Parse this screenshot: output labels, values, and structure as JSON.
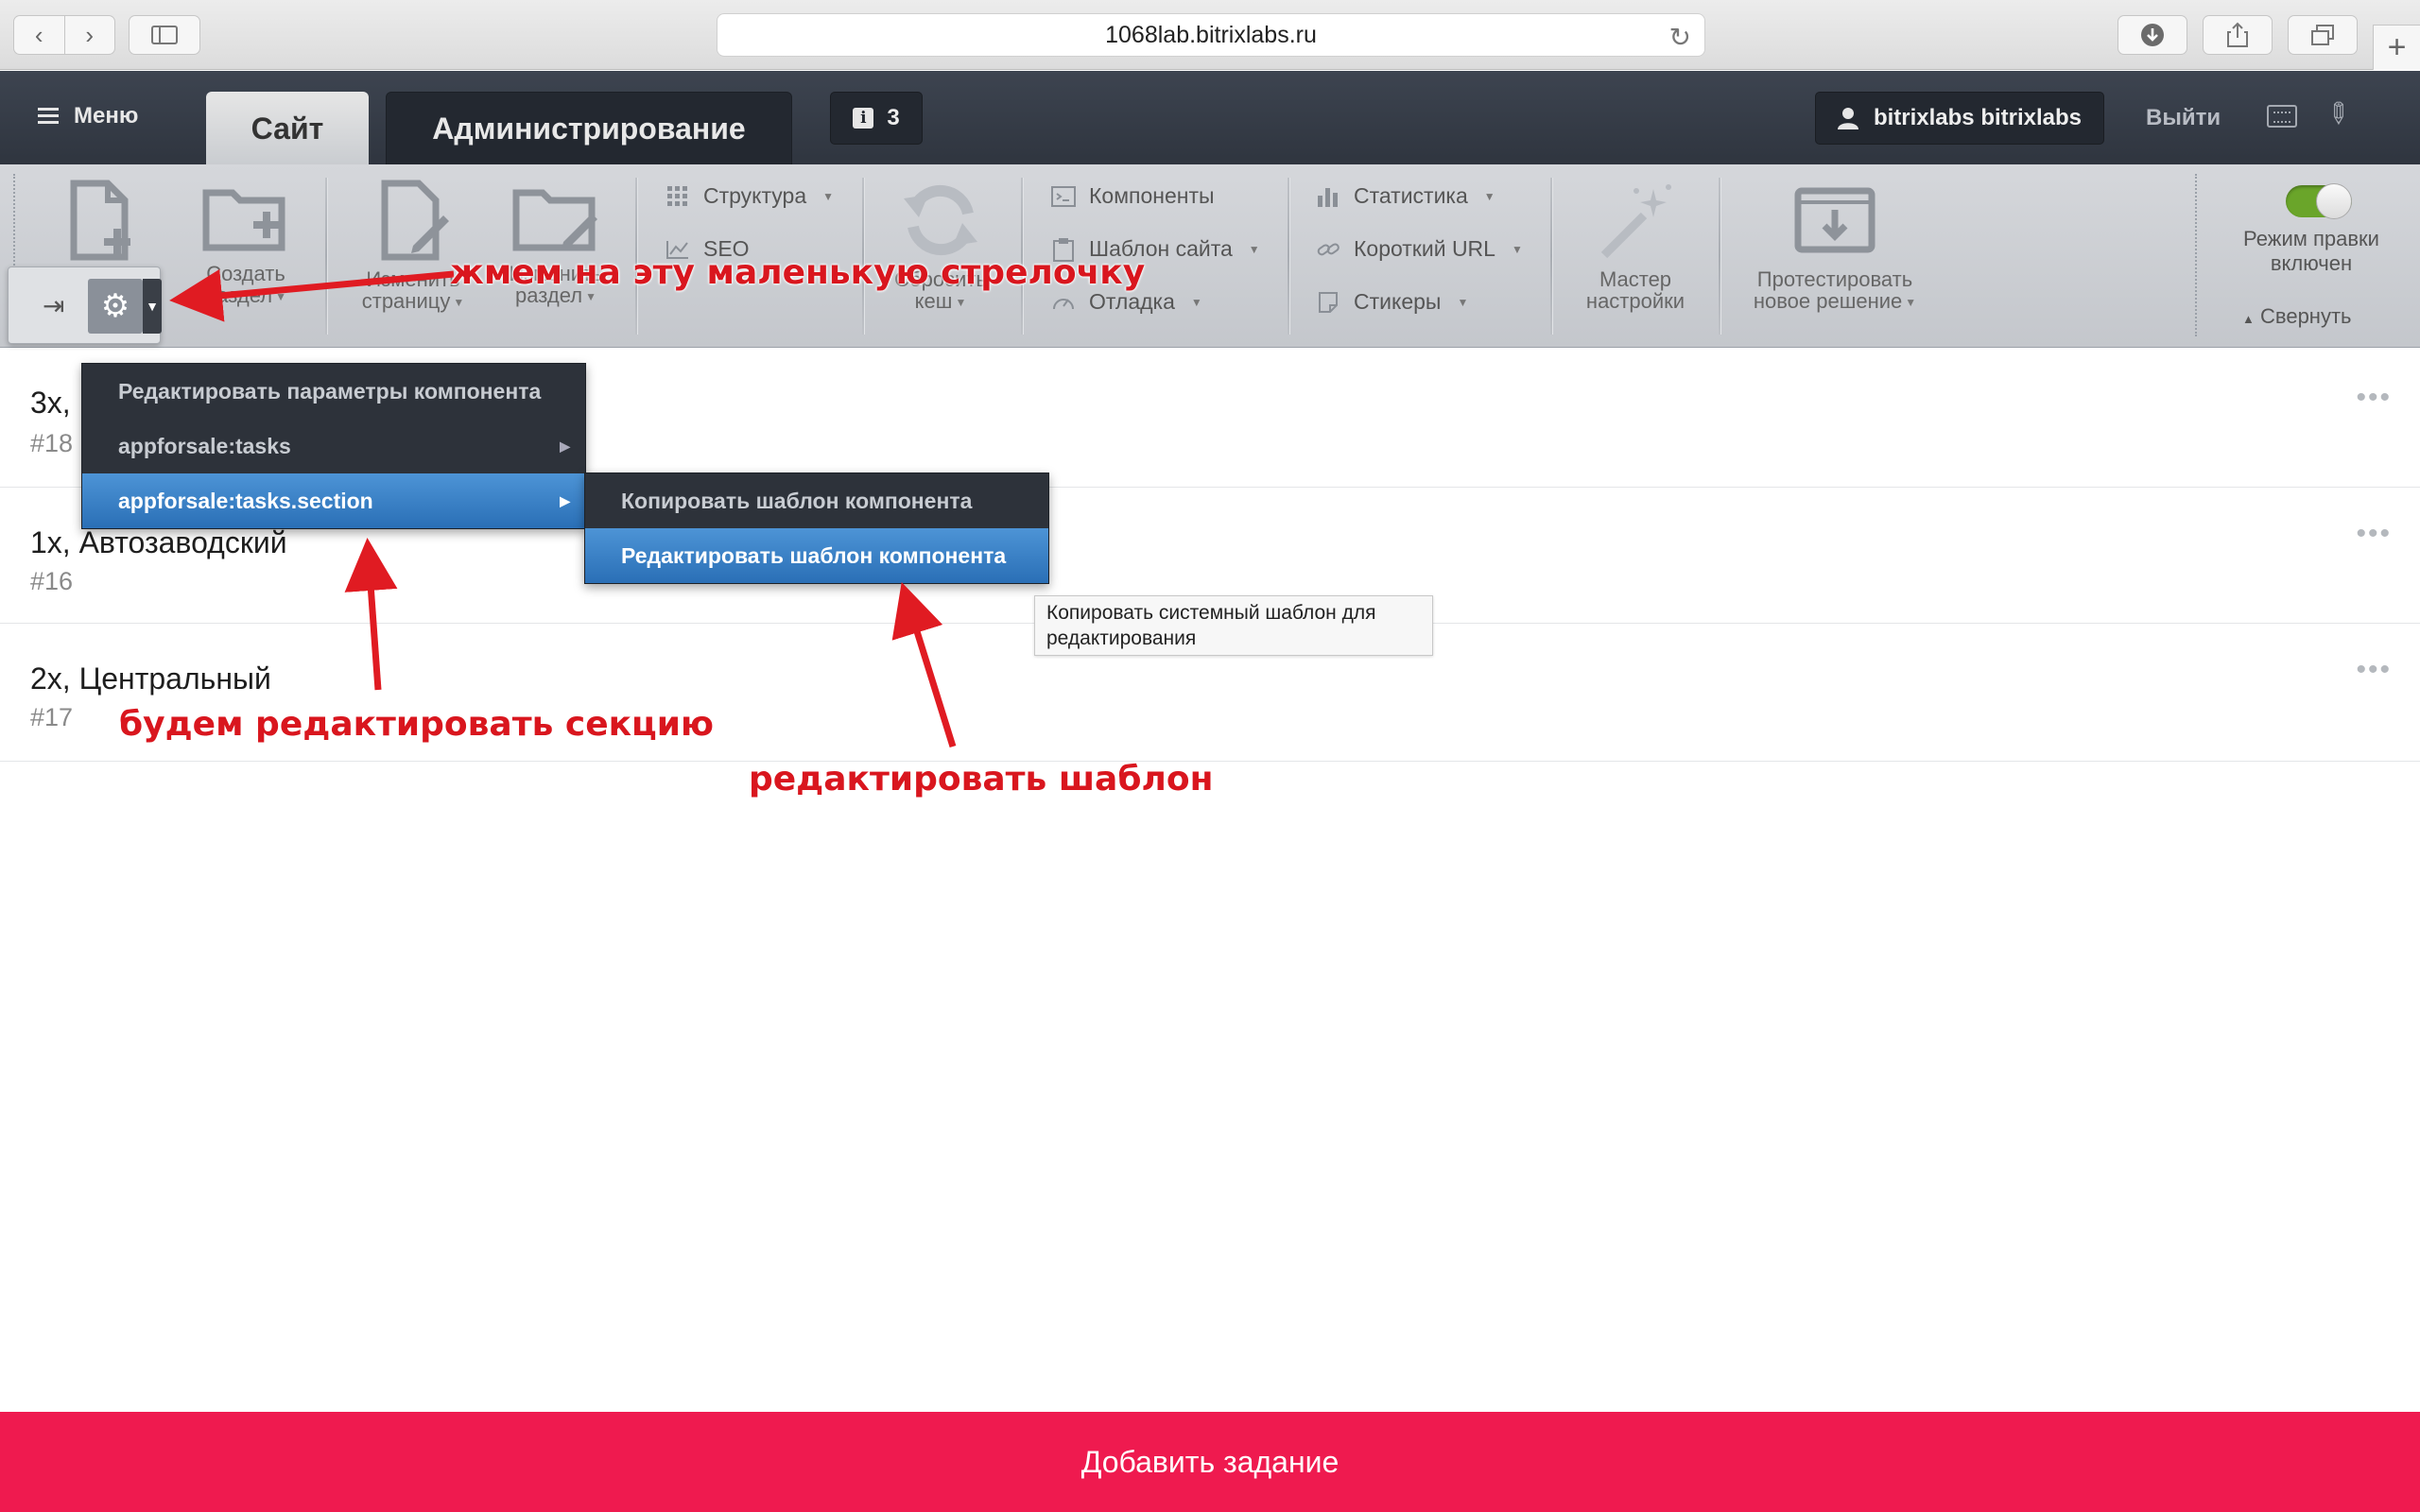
{
  "browser": {
    "url": "1068lab.bitrixlabs.ru"
  },
  "panel": {
    "menu_label": "Меню",
    "tab_site": "Сайт",
    "tab_admin": "Администрирование",
    "notifications_count": "3",
    "user_name": "bitrixlabs bitrixlabs",
    "logout_label": "Выйти",
    "tools": {
      "create_page_label": "",
      "create_section": [
        "Создать",
        "раздел"
      ],
      "edit_page": [
        "Изменить",
        "страницу"
      ],
      "edit_section": [
        "Изменить",
        "раздел"
      ],
      "structure": "Структура",
      "seo": "SEO",
      "reset_cache": [
        "Сбросить",
        "кеш"
      ],
      "components": "Компоненты",
      "site_template": "Шаблон сайта",
      "debug": "Отладка",
      "statistics": "Статистика",
      "short_url": "Короткий URL",
      "stickers": "Стикеры",
      "wizard": [
        "Мастер",
        "настройки"
      ],
      "test_solution": [
        "Протестировать",
        "новое решение"
      ],
      "edit_mode": [
        "Режим правки",
        "включен"
      ],
      "collapse": "Свернуть"
    }
  },
  "list": {
    "rows": [
      {
        "title": "3х, Комсомольский",
        "id": "#18"
      },
      {
        "title": "1х, Автозаводский",
        "id": "#16"
      },
      {
        "title": "2х, Центральный",
        "id": "#17"
      }
    ],
    "more_label": "•••"
  },
  "context_menu": {
    "items": [
      "Редактировать параметры компонента",
      "appforsale:tasks",
      "appforsale:tasks.section"
    ],
    "submenu": [
      "Копировать шаблон компонента",
      "Редактировать шаблон компонента"
    ],
    "tooltip": [
      "Копировать системный шаблон для",
      "редактирования"
    ]
  },
  "annotations": {
    "click_arrow": "жмем на эту маленькую стрелочку",
    "edit_section": "будем редактировать секцию",
    "edit_template": "редактировать шаблон"
  },
  "footer": {
    "add_task": "Добавить задание"
  },
  "colors": {
    "accent_footer": "#ef1a4f",
    "menu_highlight": "#3a82c8",
    "annotation": "#d9161e",
    "toggle_on": "#6aa52a"
  }
}
